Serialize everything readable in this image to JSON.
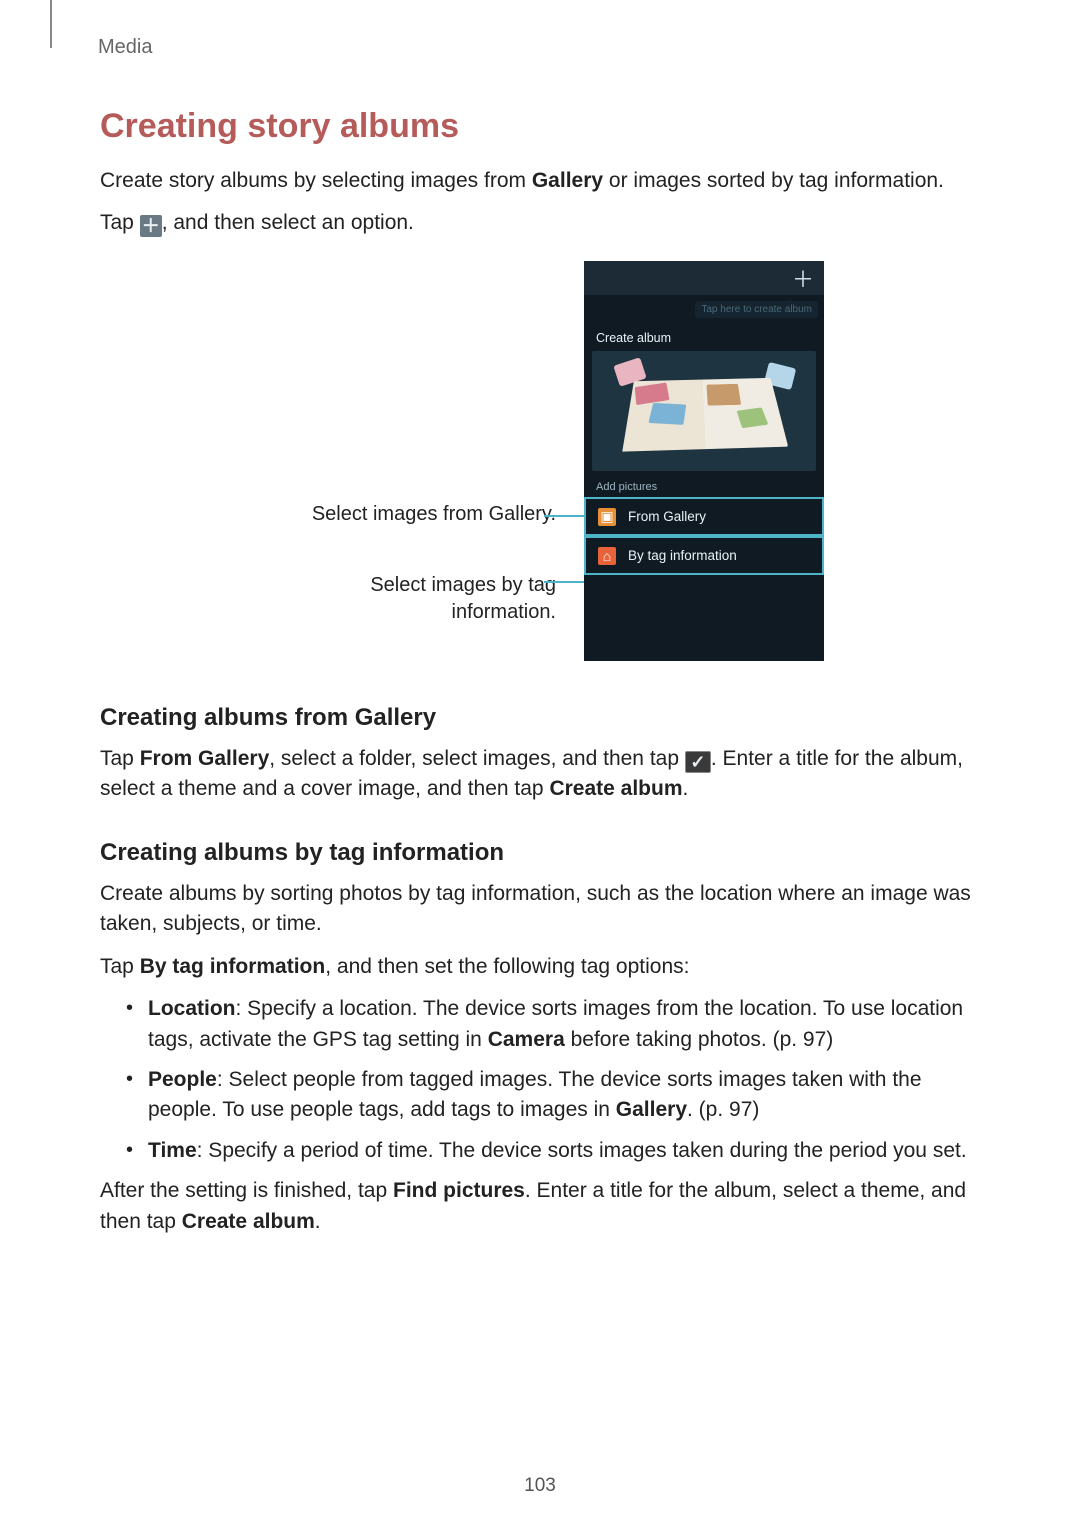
{
  "header": {
    "section": "Media"
  },
  "main_heading": "Creating story albums",
  "intro": {
    "p1_pre": "Create story albums by selecting images from ",
    "p1_bold": "Gallery",
    "p1_post": " or images sorted by tag information.",
    "p2_pre": "Tap ",
    "p2_post": ", and then select an option."
  },
  "figure": {
    "callout_gallery": "Select images from Gallery.",
    "callout_tag_l1": "Select images by tag",
    "callout_tag_l2": "information.",
    "phone": {
      "plus_glyph": "＋",
      "tooltip": "Tap here to create album",
      "panel_create": "Create album",
      "panel_add": "Add pictures",
      "item_from_gallery": "From Gallery",
      "item_by_tag": "By tag information"
    }
  },
  "sub1": {
    "heading": "Creating albums from Gallery",
    "p_pre": "Tap ",
    "p_b1": "From Gallery",
    "p_mid": ", select a folder, select images, and then tap ",
    "p_post": ". Enter a title for the album, select a theme and a cover image, and then tap ",
    "p_b2": "Create album",
    "p_end": "."
  },
  "sub2": {
    "heading": "Creating albums by tag information",
    "p1": "Create albums by sorting photos by tag information, such as the location where an image was taken, subjects, or time.",
    "p2_pre": "Tap ",
    "p2_b": "By tag information",
    "p2_post": ", and then set the following tag options:",
    "items": {
      "location": {
        "b": "Location",
        "t1": ": Specify a location. The device sorts images from the location. To use location tags, activate the GPS tag setting in ",
        "b2": "Camera",
        "t2": " before taking photos. (p. 97)"
      },
      "people": {
        "b": "People",
        "t1": ": Select people from tagged images. The device sorts images taken with the people. To use people tags, add tags to images in ",
        "b2": "Gallery",
        "t2": ". (p. 97)"
      },
      "time": {
        "b": "Time",
        "t": ": Specify a period of time. The device sorts images taken during the period you set."
      }
    },
    "p3_pre": "After the setting is finished, tap ",
    "p3_b1": "Find pictures",
    "p3_mid": ". Enter a title for the album, select a theme, and then tap ",
    "p3_b2": "Create album",
    "p3_end": "."
  },
  "page_number": "103"
}
